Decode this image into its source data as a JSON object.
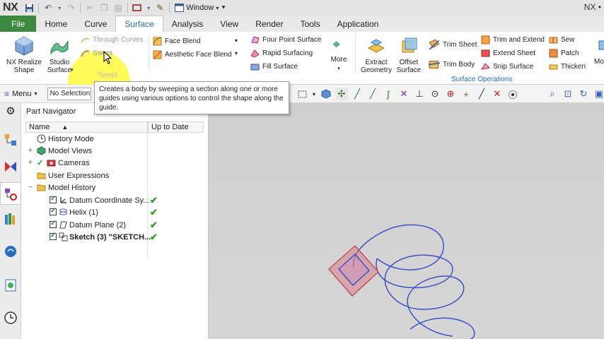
{
  "app": {
    "logo": "NX",
    "title_right": "NX •"
  },
  "quick_access": {
    "window_menu": "Window"
  },
  "tabs": [
    "File",
    "Home",
    "Curve",
    "Surface",
    "Analysis",
    "View",
    "Render",
    "Tools",
    "Application"
  ],
  "active_tab": "Surface",
  "ribbon": {
    "realize_shape": "NX Realize Shape",
    "studio_surface": "Studio Surface",
    "through_curves": "Through Curves",
    "swept": "Swept",
    "face_blend": "Face Blend",
    "aesthetic_face_blend": "Aesthetic Face Blend",
    "four_point_surface": "Four Point Surface",
    "rapid_surfacing": "Rapid Surfacing",
    "fill_surface": "Fill Surface",
    "more": "More",
    "extract_geometry": "Extract Geometry",
    "offset_surface": "Offset Surface",
    "trim_sheet": "Trim Sheet",
    "trim_body": "Trim Body",
    "trim_and_extend": "Trim and Extend",
    "extend_sheet": "Extend Sheet",
    "snip_surface": "Snip Surface",
    "sew": "Sew",
    "patch": "Patch",
    "thicken": "Thicken",
    "group_label": "Surface Operations"
  },
  "selection_bar": {
    "menu": "Menu",
    "filter": "No Selection Filter"
  },
  "navigator": {
    "title": "Part Navigator",
    "col_name": "Name",
    "col_status": "Up to Date",
    "rows": [
      {
        "label": "History Mode"
      },
      {
        "label": "Model Views"
      },
      {
        "label": "Cameras"
      },
      {
        "label": "User Expressions"
      },
      {
        "label": "Model History"
      },
      {
        "label": "Datum Coordinate Sy..."
      },
      {
        "label": "Helix (1)"
      },
      {
        "label": "Datum Plane (2)"
      },
      {
        "label": "Sketch (3) \"SKETCH..."
      }
    ]
  },
  "tooltip": {
    "title": "Swept",
    "text": "Creates a body by sweeping a section along one or more guides using various options to control the shape along the guide."
  },
  "colors": {
    "file_tab": "#3b8a3e",
    "active_tab_text": "#1d6dbd",
    "highlight": "#fff83c",
    "helix": "#3f51c6",
    "check": "#22a322"
  }
}
